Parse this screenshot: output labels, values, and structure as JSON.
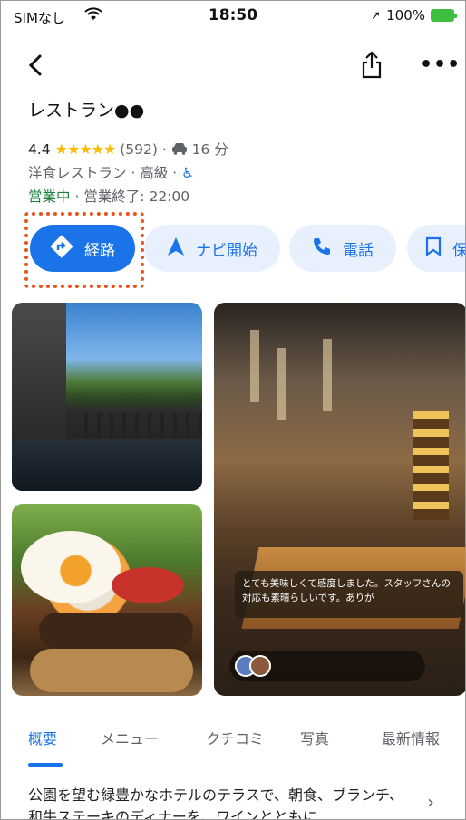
{
  "status_bar": {
    "carrier": "SIMなし",
    "time": "18:50",
    "battery": "100%"
  },
  "header": {
    "more": "•••"
  },
  "place": {
    "name": "レストラン●●",
    "rating": "4.4",
    "stars": "★★★★★",
    "review_count": "(592)",
    "drive_time": "16 分",
    "category": "洋食レストラン · 高級 ·",
    "open_status": "営業中",
    "closing": "· 営業終了: 22:00"
  },
  "actions": {
    "directions": "経路",
    "start_nav": "ナビ開始",
    "call": "電話",
    "save": "保"
  },
  "review_snippet": {
    "text": "とても美味しくて感度しました。スタッフさんの対応も素晴らしいです。ありが"
  },
  "tabs": [
    {
      "label": "概要"
    },
    {
      "label": "メニュー"
    },
    {
      "label": "クチコミ"
    },
    {
      "label": "写真"
    },
    {
      "label": "最新情報"
    }
  ],
  "description": "公園を望む緑豊かなホテルのテラスで、朝食、ブランチ、和牛ステーキのディナーを、ワインとともに…",
  "colors": {
    "accent": "#1a73e8",
    "open": "#188038",
    "star": "#fbbc04",
    "highlight": "#e8531c"
  }
}
